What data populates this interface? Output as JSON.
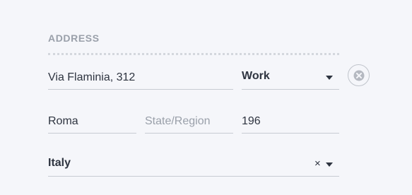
{
  "section": {
    "title": "ADDRESS"
  },
  "address": {
    "street_value": "Via Flaminia, 312",
    "type_value": "Work",
    "city_value": "Roma",
    "state_placeholder": "State/Region",
    "state_value": "",
    "postal_value": "196",
    "country_value": "Italy",
    "country_clear_glyph": "×"
  },
  "icons": {
    "remove": "close-circle-icon",
    "type_dropdown": "caret-down-icon",
    "country_dropdown": "caret-down-icon"
  },
  "colors": {
    "background": "#f5f6fa",
    "text": "#2e3440",
    "muted": "#9aa0aa",
    "underline": "#c7cbd2"
  }
}
